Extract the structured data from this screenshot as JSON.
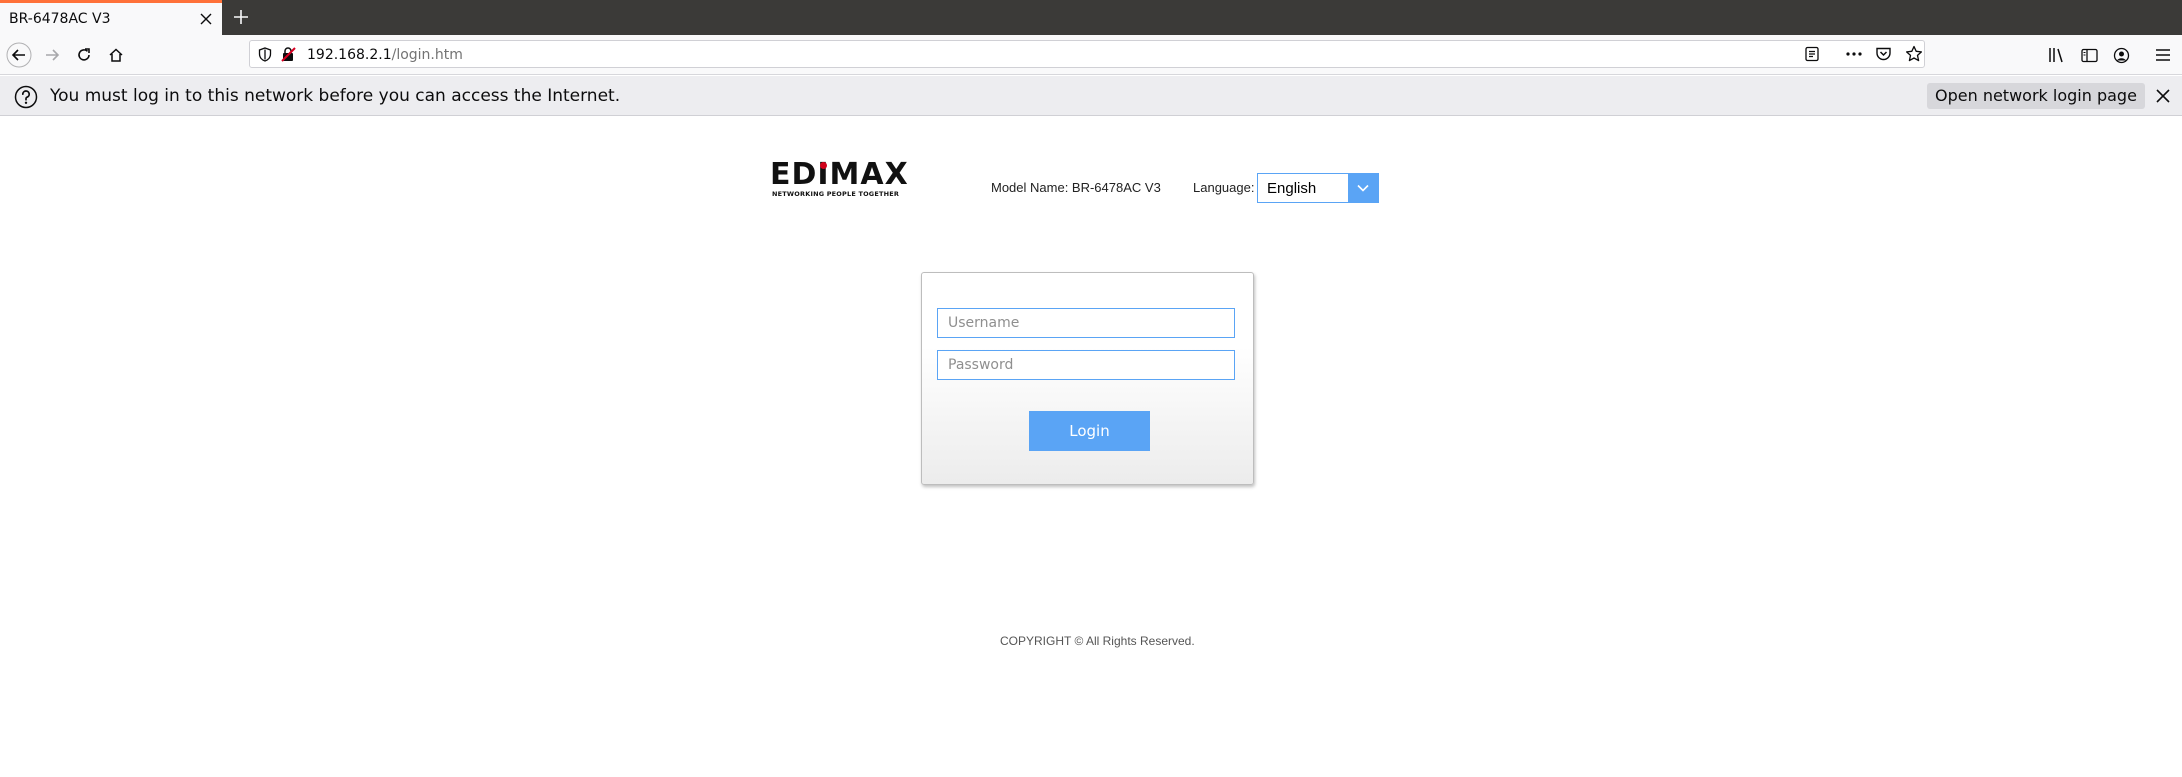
{
  "browser": {
    "tab": {
      "title": "BR-6478AC V3"
    },
    "url": {
      "host": "192.168.2.1",
      "path": "/login.htm"
    },
    "icons": {
      "back": "back-arrow-icon",
      "forward": "forward-arrow-icon",
      "reload": "reload-icon",
      "home": "home-icon",
      "shield": "tracking-shield-icon",
      "insecure": "insecure-lock-icon",
      "reader": "reader-view-icon",
      "more": "page-actions-icon",
      "pocket": "pocket-icon",
      "bookmark": "bookmark-star-icon",
      "library": "library-icon",
      "sidebar": "sidebar-icon",
      "account": "account-icon",
      "menu": "hamburger-menu-icon"
    },
    "notification": {
      "text": "You must log in to this network before you can access the Internet.",
      "button": "Open network login page"
    }
  },
  "header": {
    "logo_text": "EDIMAX",
    "logo_tagline": "NETWORKING PEOPLE TOGETHER",
    "model_name": "Model Name: BR-6478AC V3",
    "language_label": "Language:",
    "language_value": "English"
  },
  "login": {
    "username_placeholder": "Username",
    "password_placeholder": "Password",
    "button_label": "Login"
  },
  "footer": {
    "copyright": "COPYRIGHT © All Rights Reserved."
  },
  "colors": {
    "accent_blue": "#5aa4f5",
    "tab_strip": "#3b3a38",
    "tab_highlight": "#ff7139",
    "notification_bg": "#ededf0"
  }
}
